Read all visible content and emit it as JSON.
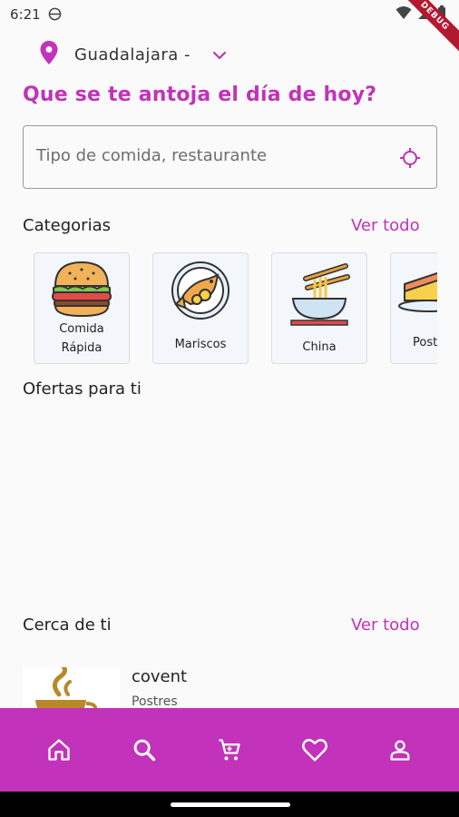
{
  "status": {
    "time": "6:21",
    "debug_label": "DEBUG"
  },
  "location": {
    "label": "Guadalajara -"
  },
  "headline": "Que se te antoja el día de hoy?",
  "search": {
    "placeholder": "Tipo de comida, restaurante"
  },
  "categories_section": {
    "title": "Categorias",
    "see_all": "Ver todo",
    "items": [
      {
        "label": "Comida\nRápida",
        "icon": "burger-icon"
      },
      {
        "label": "Mariscos",
        "icon": "fish-icon"
      },
      {
        "label": "China",
        "icon": "noodles-icon"
      },
      {
        "label": "Postres",
        "icon": "cake-icon"
      }
    ]
  },
  "offers_section": {
    "title": "Ofertas para ti"
  },
  "nearby_section": {
    "title": "Cerca de ti",
    "see_all": "Ver todo",
    "items": [
      {
        "name": "covent",
        "category": "Postres"
      }
    ]
  },
  "bottom_nav": {
    "items": [
      "home-icon",
      "search-icon",
      "cart-icon",
      "heart-icon",
      "person-icon"
    ]
  },
  "colors": {
    "accent": "#c232ba",
    "card_bg": "#f3f6fb"
  }
}
